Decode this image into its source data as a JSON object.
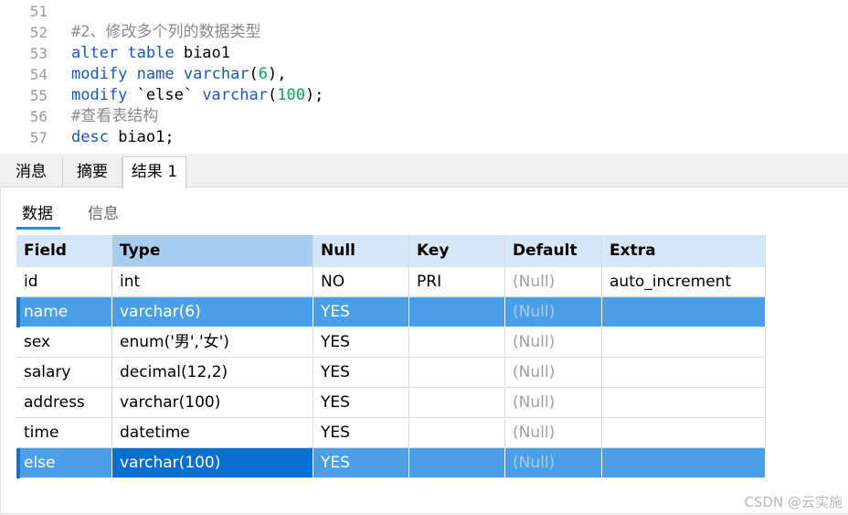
{
  "editor": {
    "lines": [
      {
        "num": "51",
        "html": ""
      },
      {
        "num": "52",
        "html": "<span class='cm'>#2、修改多个列的数据类型</span>"
      },
      {
        "num": "53",
        "html": "<span class='kw'>alter table</span> biao1"
      },
      {
        "num": "54",
        "html": "<span class='kw'>modify</span> <span class='kw'>name</span> <span class='kw'>varchar</span>(<span class='num'>6</span>),"
      },
      {
        "num": "55",
        "html": "<span class='kw'>modify</span> `else` <span class='kw'>varchar</span>(<span class='num'>100</span>);"
      },
      {
        "num": "56",
        "html": "<span class='cm'>#查看表结构</span>"
      },
      {
        "num": "57",
        "html": "<span class='kw'>desc</span> biao1;"
      }
    ]
  },
  "tabs": {
    "messages": "消息",
    "summary": "摘要",
    "result1": "结果 1"
  },
  "subtabs": {
    "data": "数据",
    "info": "信息"
  },
  "table": {
    "columns": [
      "Field",
      "Type",
      "Null",
      "Key",
      "Default",
      "Extra"
    ],
    "rows": [
      [
        "id",
        "int",
        "NO",
        "PRI",
        "(Null)",
        "auto_increment"
      ],
      [
        "name",
        "varchar(6)",
        "YES",
        "",
        "(Null)",
        ""
      ],
      [
        "sex",
        "enum('男','女')",
        "YES",
        "",
        "(Null)",
        ""
      ],
      [
        "salary",
        "decimal(12,2)",
        "YES",
        "",
        "(Null)",
        ""
      ],
      [
        "address",
        "varchar(100)",
        "YES",
        "",
        "(Null)",
        ""
      ],
      [
        "time",
        "datetime",
        "YES",
        "",
        "(Null)",
        ""
      ],
      [
        "else",
        "varchar(100)",
        "YES",
        "",
        "(Null)",
        ""
      ]
    ],
    "selected_rows": [
      1,
      6
    ],
    "focused_cell": {
      "row": 6,
      "col": 1
    }
  },
  "watermark": "CSDN @云实施"
}
